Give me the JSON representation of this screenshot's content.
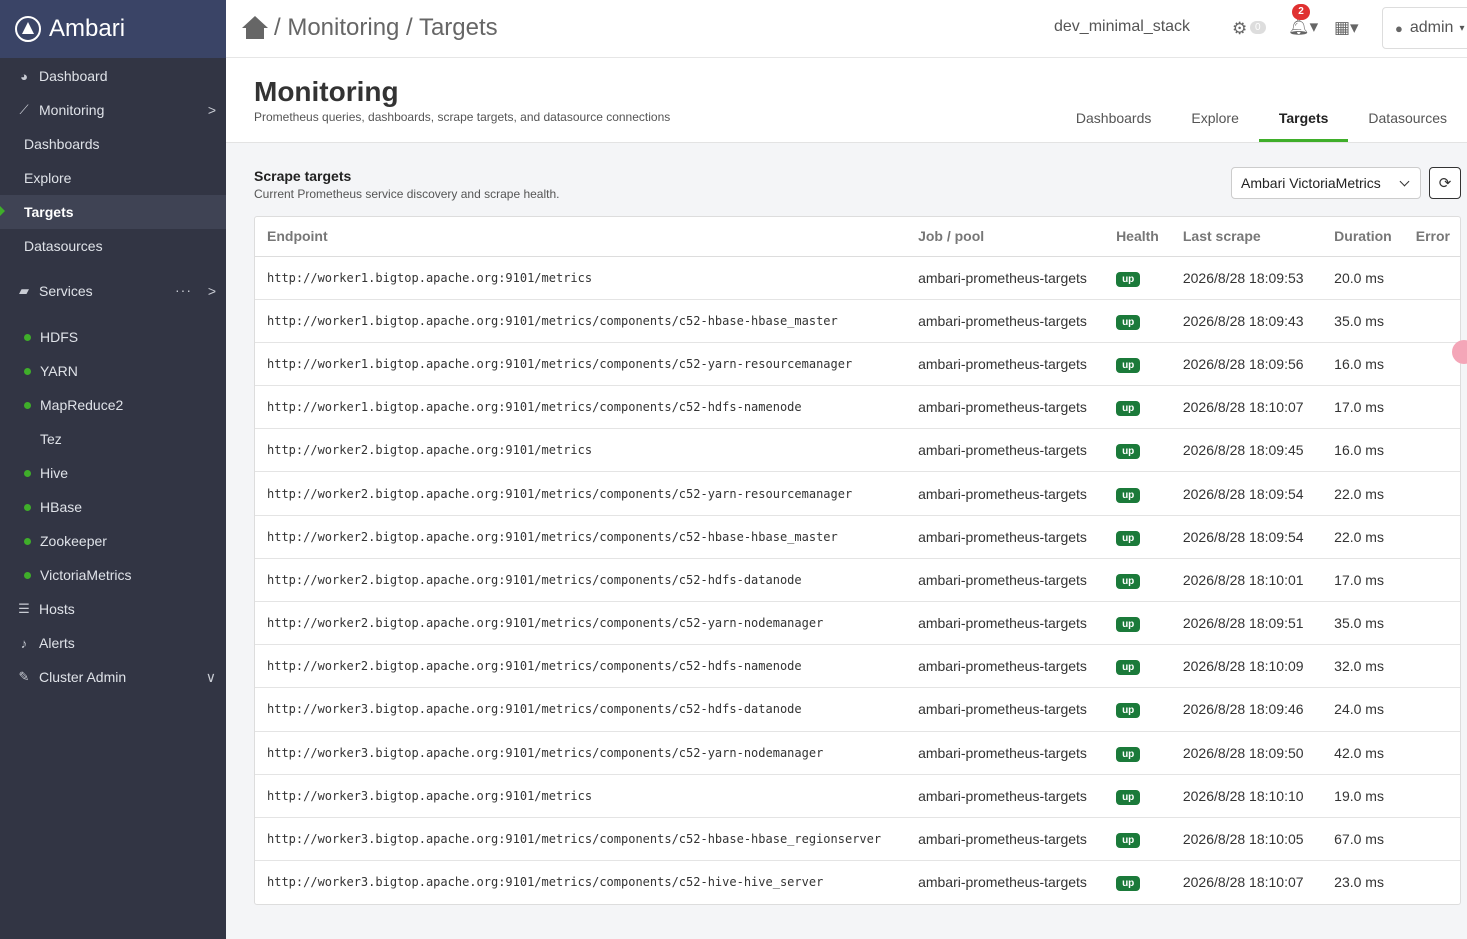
{
  "brand": "Ambari",
  "sidebar": {
    "items": [
      {
        "label": "Dashboard",
        "icon": "palette-icon"
      },
      {
        "label": "Monitoring",
        "icon": "chart-line-icon"
      },
      {
        "label": "Dashboards"
      },
      {
        "label": "Explore"
      },
      {
        "label": "Targets"
      },
      {
        "label": "Datasources"
      },
      {
        "label": "Services",
        "icon": "briefcase-icon"
      },
      {
        "label": "Hosts",
        "icon": "server-icon"
      },
      {
        "label": "Alerts",
        "icon": "bell-icon"
      },
      {
        "label": "Cluster Admin",
        "icon": "wrench-icon"
      }
    ],
    "services": [
      {
        "label": "HDFS",
        "status": "green"
      },
      {
        "label": "YARN",
        "status": "green"
      },
      {
        "label": "MapReduce2",
        "status": "green"
      },
      {
        "label": "Tez",
        "status": "none"
      },
      {
        "label": "Hive",
        "status": "green"
      },
      {
        "label": "HBase",
        "status": "green"
      },
      {
        "label": "Zookeeper",
        "status": "green"
      },
      {
        "label": "VictoriaMetrics",
        "status": "green"
      }
    ],
    "services_more": "···"
  },
  "header": {
    "breadcrumb": "/ Monitoring / Targets",
    "cluster_name": "dev_minimal_stack",
    "ops_count": "0",
    "alerts_count": "2",
    "user": "admin"
  },
  "page": {
    "title": "Monitoring",
    "subtitle": "Prometheus queries, dashboards, scrape targets, and datasource connections",
    "tabs": [
      "Dashboards",
      "Explore",
      "Targets",
      "Datasources"
    ],
    "active_tab": "Targets"
  },
  "section": {
    "title": "Scrape targets",
    "description": "Current Prometheus service discovery and scrape health.",
    "datasource": "Ambari VictoriaMetrics"
  },
  "table": {
    "headers": [
      "Endpoint",
      "Job / pool",
      "Health",
      "Last scrape",
      "Duration",
      "Error"
    ],
    "rows": [
      {
        "endpoint": "http://worker1.bigtop.apache.org:9101/metrics",
        "job": "ambari-prometheus-targets",
        "health": "up",
        "last": "2026/8/28 18:09:53",
        "duration": "20.0 ms",
        "error": ""
      },
      {
        "endpoint": "http://worker1.bigtop.apache.org:9101/metrics/components/c52-hbase-hbase_master",
        "job": "ambari-prometheus-targets",
        "health": "up",
        "last": "2026/8/28 18:09:43",
        "duration": "35.0 ms",
        "error": ""
      },
      {
        "endpoint": "http://worker1.bigtop.apache.org:9101/metrics/components/c52-yarn-resourcemanager",
        "job": "ambari-prometheus-targets",
        "health": "up",
        "last": "2026/8/28 18:09:56",
        "duration": "16.0 ms",
        "error": ""
      },
      {
        "endpoint": "http://worker1.bigtop.apache.org:9101/metrics/components/c52-hdfs-namenode",
        "job": "ambari-prometheus-targets",
        "health": "up",
        "last": "2026/8/28 18:10:07",
        "duration": "17.0 ms",
        "error": ""
      },
      {
        "endpoint": "http://worker2.bigtop.apache.org:9101/metrics",
        "job": "ambari-prometheus-targets",
        "health": "up",
        "last": "2026/8/28 18:09:45",
        "duration": "16.0 ms",
        "error": ""
      },
      {
        "endpoint": "http://worker2.bigtop.apache.org:9101/metrics/components/c52-yarn-resourcemanager",
        "job": "ambari-prometheus-targets",
        "health": "up",
        "last": "2026/8/28 18:09:54",
        "duration": "22.0 ms",
        "error": ""
      },
      {
        "endpoint": "http://worker2.bigtop.apache.org:9101/metrics/components/c52-hbase-hbase_master",
        "job": "ambari-prometheus-targets",
        "health": "up",
        "last": "2026/8/28 18:09:54",
        "duration": "22.0 ms",
        "error": ""
      },
      {
        "endpoint": "http://worker2.bigtop.apache.org:9101/metrics/components/c52-hdfs-datanode",
        "job": "ambari-prometheus-targets",
        "health": "up",
        "last": "2026/8/28 18:10:01",
        "duration": "17.0 ms",
        "error": ""
      },
      {
        "endpoint": "http://worker2.bigtop.apache.org:9101/metrics/components/c52-yarn-nodemanager",
        "job": "ambari-prometheus-targets",
        "health": "up",
        "last": "2026/8/28 18:09:51",
        "duration": "35.0 ms",
        "error": ""
      },
      {
        "endpoint": "http://worker2.bigtop.apache.org:9101/metrics/components/c52-hdfs-namenode",
        "job": "ambari-prometheus-targets",
        "health": "up",
        "last": "2026/8/28 18:10:09",
        "duration": "32.0 ms",
        "error": ""
      },
      {
        "endpoint": "http://worker3.bigtop.apache.org:9101/metrics/components/c52-hdfs-datanode",
        "job": "ambari-prometheus-targets",
        "health": "up",
        "last": "2026/8/28 18:09:46",
        "duration": "24.0 ms",
        "error": ""
      },
      {
        "endpoint": "http://worker3.bigtop.apache.org:9101/metrics/components/c52-yarn-nodemanager",
        "job": "ambari-prometheus-targets",
        "health": "up",
        "last": "2026/8/28 18:09:50",
        "duration": "42.0 ms",
        "error": ""
      },
      {
        "endpoint": "http://worker3.bigtop.apache.org:9101/metrics",
        "job": "ambari-prometheus-targets",
        "health": "up",
        "last": "2026/8/28 18:10:10",
        "duration": "19.0 ms",
        "error": ""
      },
      {
        "endpoint": "http://worker3.bigtop.apache.org:9101/metrics/components/c52-hbase-hbase_regionserver",
        "job": "ambari-prometheus-targets",
        "health": "up",
        "last": "2026/8/28 18:10:05",
        "duration": "67.0 ms",
        "error": ""
      },
      {
        "endpoint": "http://worker3.bigtop.apache.org:9101/metrics/components/c52-hive-hive_server",
        "job": "ambari-prometheus-targets",
        "health": "up",
        "last": "2026/8/28 18:10:07",
        "duration": "23.0 ms",
        "error": ""
      }
    ]
  },
  "colors": {
    "sidebar_bg": "#323544",
    "brand_bg": "#3a4466",
    "accent": "#3fae2a",
    "health_up": "#1b7a3a",
    "alert_badge": "#e03131"
  }
}
